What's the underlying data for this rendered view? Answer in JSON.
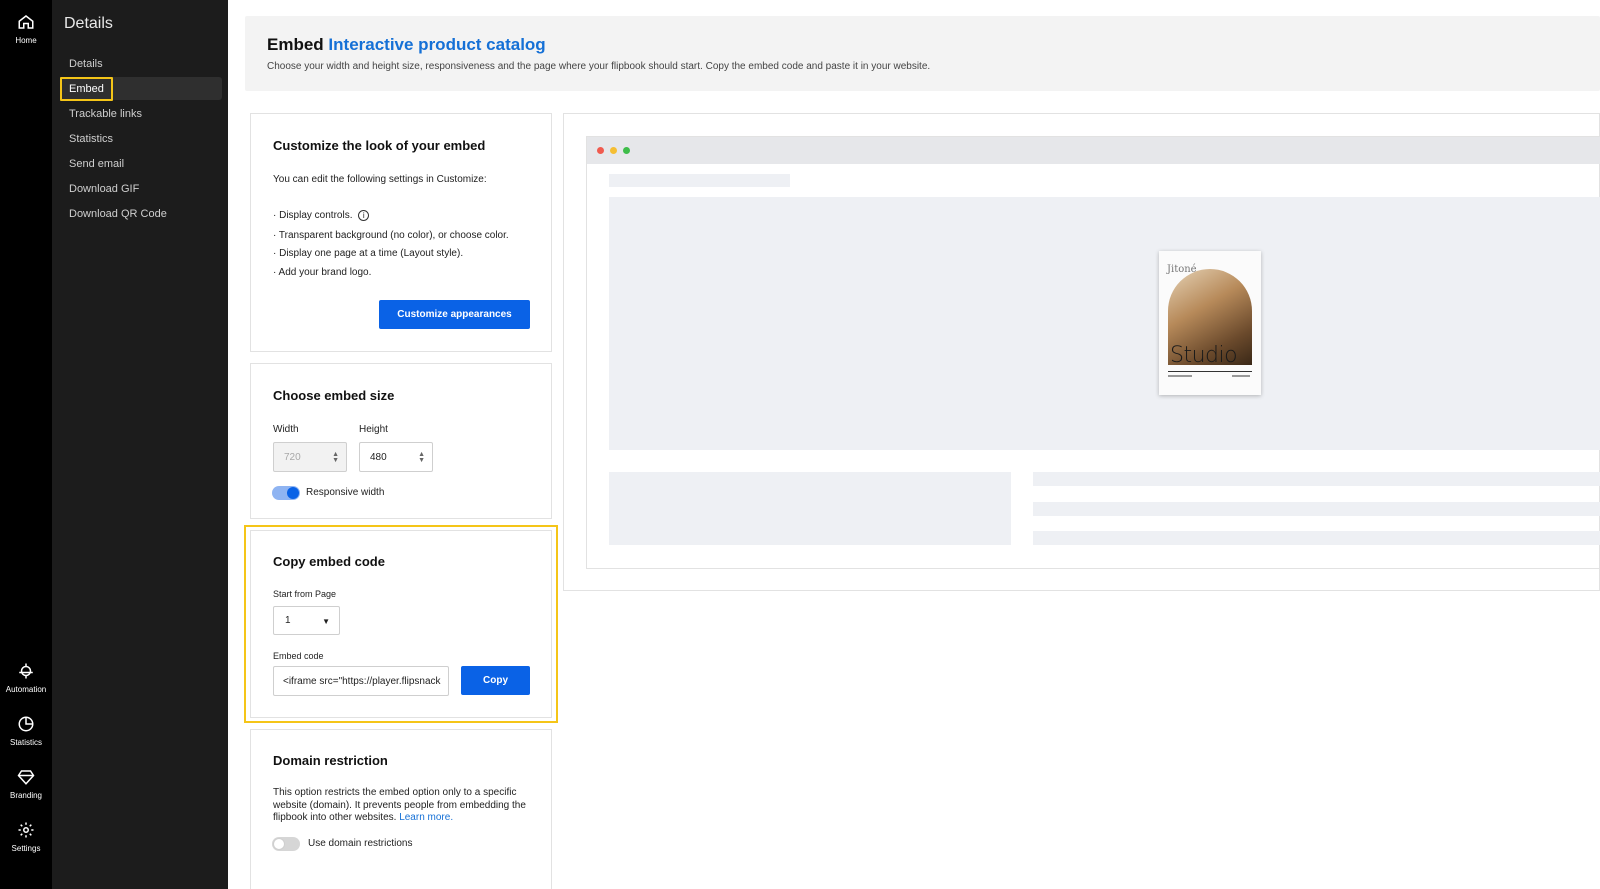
{
  "rail": {
    "home": "Home",
    "automation": "Automation",
    "statistics": "Statistics",
    "branding": "Branding",
    "settings": "Settings"
  },
  "sidebar": {
    "title": "Details",
    "items": [
      "Details",
      "Embed",
      "Trackable links",
      "Statistics",
      "Send email",
      "Download GIF",
      "Download QR Code"
    ],
    "active": "Embed"
  },
  "header": {
    "title_prefix": "Embed",
    "title_link": "Interactive product catalog",
    "subtitle": "Choose your width and height size, responsiveness and the page where your flipbook should start. Copy the embed code and paste it in your website."
  },
  "customize": {
    "heading": "Customize the look of your embed",
    "intro": "You can edit the following settings in Customize:",
    "bullets": [
      "· Display controls.",
      "· Transparent background (no color), or choose color.",
      "· Display one page at a time (Layout style).",
      "· Add your brand logo."
    ],
    "button": "Customize appearances"
  },
  "size": {
    "heading": "Choose embed size",
    "width_label": "Width",
    "width_value": "720",
    "height_label": "Height",
    "height_value": "480",
    "responsive_label": "Responsive width",
    "responsive_on": true
  },
  "copy": {
    "heading": "Copy embed code",
    "start_label": "Start from Page",
    "start_value": "1",
    "code_label": "Embed code",
    "code_value": "<iframe src=\"https://player.flipsnack",
    "copy_button": "Copy"
  },
  "domain": {
    "heading": "Domain restriction",
    "desc": "This option restricts the embed option only to a specific website (domain). It prevents people from embedding the flipbook into other websites.",
    "learn_more": "Learn more.",
    "toggle_label": "Use domain restrictions",
    "toggle_on": false
  },
  "cover": {
    "brand": "Jitoné",
    "title": "Studio"
  },
  "colors": {
    "accent": "#0a62e6",
    "link": "#1570d6",
    "highlight": "#f5c518"
  }
}
